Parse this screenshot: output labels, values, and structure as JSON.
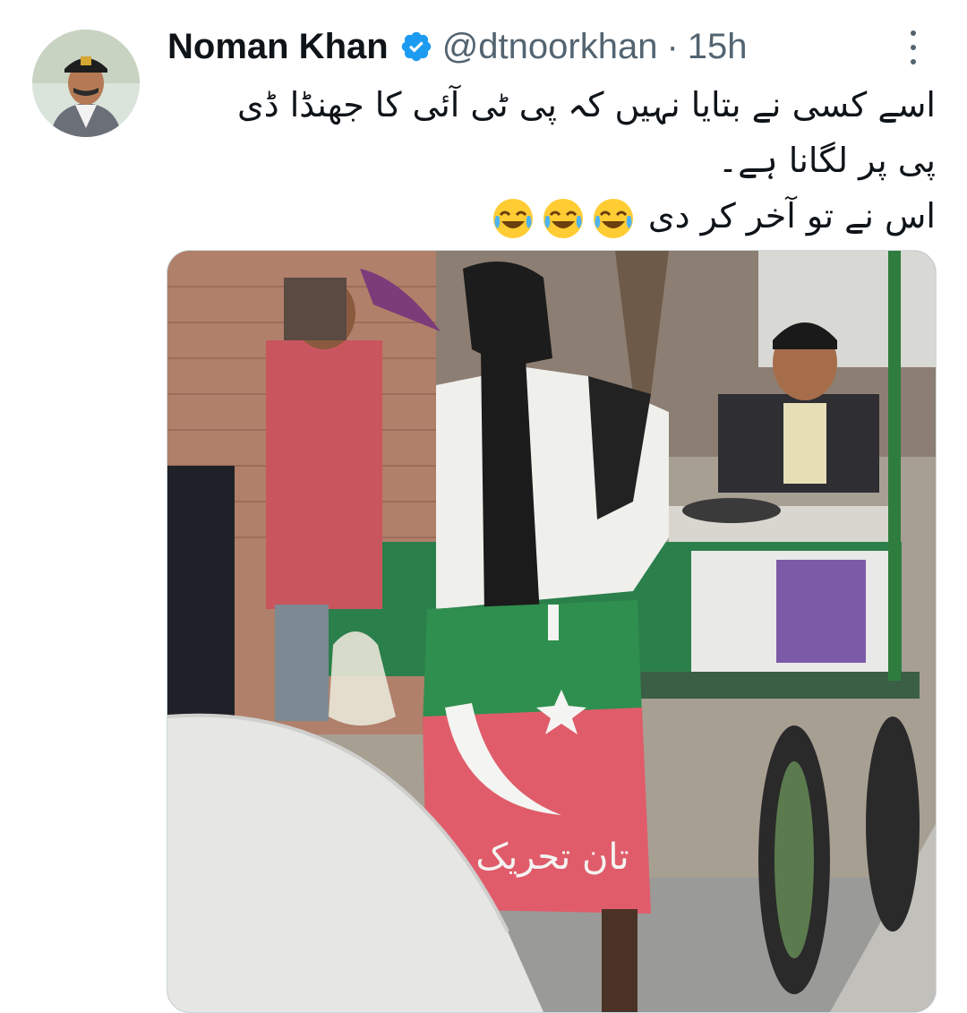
{
  "author": {
    "display_name": "Noman Khan",
    "handle": "@dtnoorkhan",
    "separator": "·",
    "timestamp": "15h",
    "verified": true,
    "verified_color": "#1d9bf0"
  },
  "tweet": {
    "lines": [
      "اسے کسی نے بتایا نہیں کہ پی ٹی آئی کا جھنڈا ڈی",
      "پی پر لگانا ہے۔",
      "اس نے تو آخر کر دی"
    ],
    "emojis": [
      "face-with-tears-of-joy",
      "face-with-tears-of-joy",
      "face-with-tears-of-joy"
    ]
  },
  "media": {
    "description_icon": "photo",
    "flag_text": "تان تحریک",
    "flag_colors": {
      "green": "#2f8f4e",
      "red": "#e05c6a",
      "white": "#f4f4f2"
    }
  },
  "colors": {
    "text": "#0f1419",
    "secondary": "#536471",
    "accent": "#1d9bf0"
  }
}
